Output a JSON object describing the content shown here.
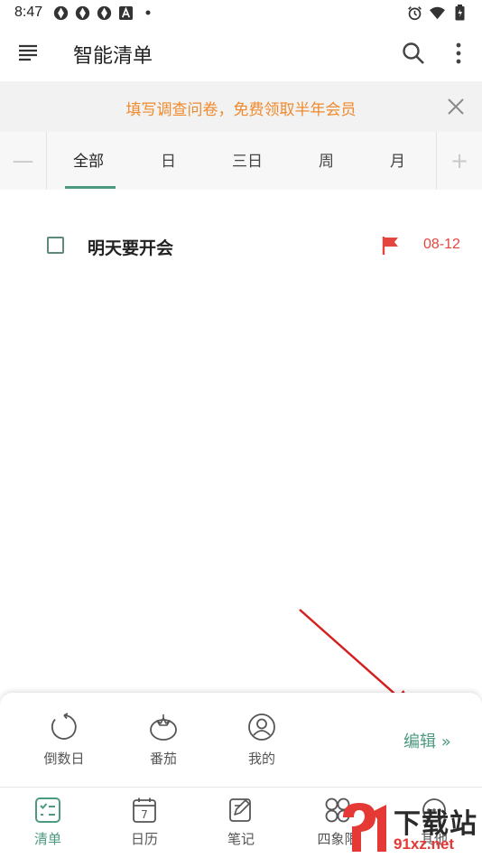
{
  "status_bar": {
    "time": "8:47",
    "notification_icons": [
      "aperture-icon",
      "aperture-icon",
      "aperture-icon",
      "a-icon",
      "dot-icon"
    ],
    "right_icons": [
      "alarm-icon",
      "wifi-icon",
      "battery-icon"
    ]
  },
  "app_bar": {
    "title": "智能清单",
    "icons": [
      "menu-icon",
      "search-icon",
      "more-vert-icon"
    ]
  },
  "banner": {
    "text": "填写调查问卷，免费领取半年会员",
    "color": "#f08a2c"
  },
  "tabs": {
    "items": [
      "全部",
      "日",
      "三日",
      "周",
      "月"
    ],
    "active_index": 0,
    "minus": "—",
    "plus": "+"
  },
  "tasks": [
    {
      "label": "明天要开会",
      "date": "08-12",
      "flag_color": "#e2463f",
      "checked": false
    }
  ],
  "panel": {
    "items": [
      {
        "label": "倒数日",
        "icon": "countdown-icon"
      },
      {
        "label": "番茄",
        "icon": "tomato-icon"
      },
      {
        "label": "我的",
        "icon": "profile-icon"
      }
    ],
    "edit": "编辑 »"
  },
  "bottom_nav": {
    "items": [
      {
        "label": "清单",
        "icon": "checklist-icon",
        "active": true
      },
      {
        "label": "日历",
        "icon": "calendar-icon",
        "day": "7"
      },
      {
        "label": "笔记",
        "icon": "note-icon"
      },
      {
        "label": "四象限",
        "icon": "quadrant-icon"
      },
      {
        "label": "其他",
        "icon": "other-icon"
      }
    ]
  },
  "watermark": {
    "title": "下载站",
    "url": "91xz.net"
  },
  "colors": {
    "accent": "#4e9a80",
    "danger": "#e2463f",
    "banner_text": "#f08a2c"
  }
}
